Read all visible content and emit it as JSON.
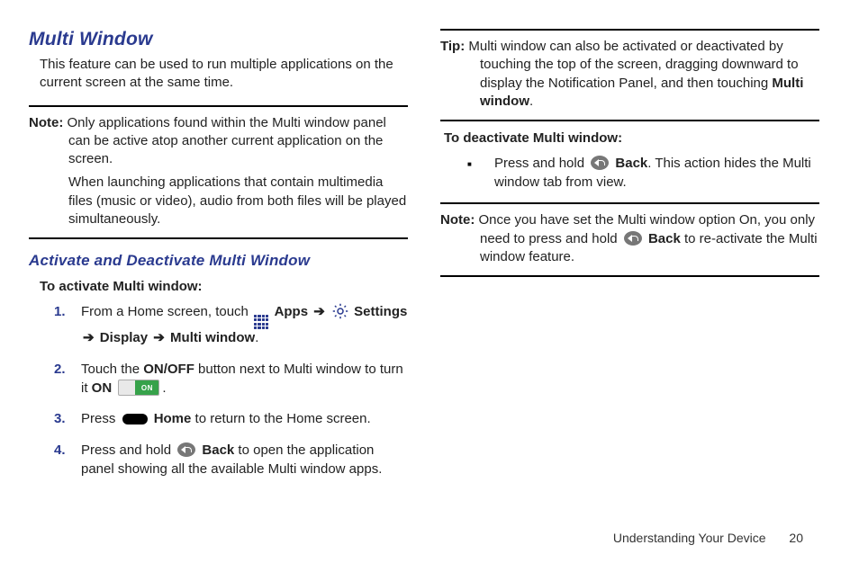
{
  "left": {
    "h1": "Multi Window",
    "intro": "This feature can be used to run multiple applications on the current screen at the same time.",
    "note_label": "Note:",
    "note_para1": "Only applications found within the Multi window panel can be active atop another current application on the screen.",
    "note_para2": "When launching applications that contain multimedia files (music or video), audio from both files will be played simultaneously.",
    "h2": "Activate and Deactivate Multi Window",
    "subhead": "To activate Multi window:",
    "steps": {
      "n1": "1.",
      "s1_a": "From a Home screen, touch ",
      "s1_apps": "Apps",
      "s1_arrow1": "➔",
      "s1_settings": "Settings",
      "s1_arrow2": "➔",
      "s1_display": "Display",
      "s1_arrow3": "➔",
      "s1_mw": "Multi window",
      "s1_end": ".",
      "n2": "2.",
      "s2_a": "Touch the ",
      "s2_onoff": "ON/OFF",
      "s2_b": " button next to Multi window to turn it ",
      "s2_on": "ON",
      "toggle_label": "ON",
      "s2_end": ".",
      "n3": "3.",
      "s3_a": "Press ",
      "s3_home": "Home",
      "s3_b": " to return to the Home screen.",
      "n4": "4.",
      "s4_a": "Press and hold ",
      "s4_back": "Back",
      "s4_b": " to open the application panel showing all the available Multi window apps."
    }
  },
  "right": {
    "tip_label": "Tip:",
    "tip_a": "Multi window can also be activated or deactivated by touching the top of the screen, dragging downward to display the Notification Panel, and then touching ",
    "tip_mw": "Multi window",
    "tip_end": ".",
    "deact_head": "To deactivate Multi window:",
    "bullet_a": "Press and hold ",
    "bullet_back": "Back",
    "bullet_b": ". This action hides the Multi window tab from view.",
    "note2_label": "Note:",
    "note2_a": "Once you have set the Multi window option On, you only need to press and hold ",
    "note2_back": "Back",
    "note2_b": " to re-activate the Multi window feature."
  },
  "footer": {
    "section": "Understanding Your Device",
    "page": "20"
  }
}
